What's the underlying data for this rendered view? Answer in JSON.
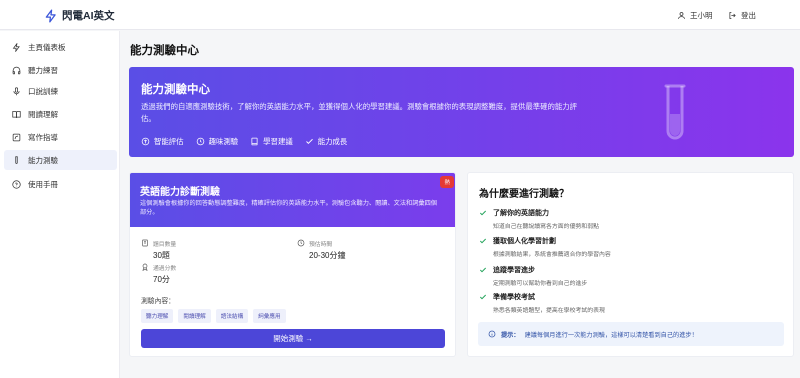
{
  "app": {
    "name": "閃電AI英文"
  },
  "header": {
    "user_name": "王小明",
    "logout_label": "登出"
  },
  "sidebar": {
    "items": [
      {
        "label": "主頁儀表板",
        "icon": "bolt-icon"
      },
      {
        "label": "聽力練習",
        "icon": "headphones-icon"
      },
      {
        "label": "口說訓練",
        "icon": "microphone-icon"
      },
      {
        "label": "閱讀理解",
        "icon": "book-open-icon"
      },
      {
        "label": "寫作指導",
        "icon": "pencil-icon"
      },
      {
        "label": "能力測驗",
        "icon": "test-tube-icon",
        "active": true
      },
      {
        "label": "使用手冊",
        "icon": "help-circle-icon"
      }
    ]
  },
  "page": {
    "title": "能力測驗中心"
  },
  "hero": {
    "title": "能力測驗中心",
    "description": "透過我們的自適應測驗技術，了解你的英語能力水平，並獲得個人化的學習建議。測驗會根據你的表現調整難度，提供最準確的能力評估。",
    "features": [
      {
        "label": "智能評估",
        "icon": "brain-icon"
      },
      {
        "label": "趣味測驗",
        "icon": "clock-icon"
      },
      {
        "label": "學習建議",
        "icon": "book-icon"
      },
      {
        "label": "能力成長",
        "icon": "check-icon"
      }
    ]
  },
  "test_card": {
    "title": "英語能力診斷測驗",
    "badge": "熱",
    "description": "這個測驗會根據你的回答動態調整難度，精確評估你的英語能力水平。測驗包含聽力、閱讀、文法和詞彙四個部分。",
    "stats": {
      "questions": {
        "label": "題目數量",
        "value": "30題"
      },
      "time": {
        "label": "預估時間",
        "value": "20-30分鐘"
      },
      "pass": {
        "label": "通過分數",
        "value": "70分"
      }
    },
    "contents_label": "測驗內容：",
    "chips": [
      "聽力理解",
      "閱讀理解",
      "語法結構",
      "詞彙應用"
    ],
    "start_label": "開始測驗 →"
  },
  "why": {
    "title": "為什麼要進行測驗？",
    "items": [
      {
        "title": "了解你的英語能力",
        "desc": "知道自己在聽說讀寫各方面的優勢和弱點"
      },
      {
        "title": "獲取個人化學習計劃",
        "desc": "根據測驗結果，系統會推薦適合你的學習內容"
      },
      {
        "title": "追蹤學習進步",
        "desc": "定期測驗可以幫助你看到自己的進步"
      },
      {
        "title": "準備學校考試",
        "desc": "熟悉各類英語題型，提高在學校考試的表現"
      }
    ],
    "tip_label": "提示：",
    "tip_text": "建議每個月進行一次能力測驗，這樣可以清楚看到自己的進步！"
  },
  "colors": {
    "accent": "#5a4ee6",
    "accent_end": "#8b34ec",
    "check": "#22a35a",
    "button": "#4c46d8"
  }
}
